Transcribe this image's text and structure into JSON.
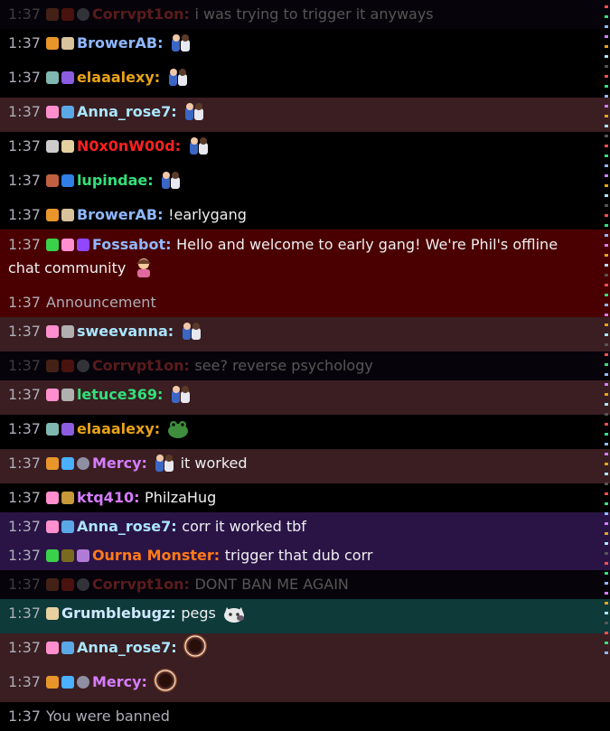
{
  "messages": [
    {
      "time": "1:37",
      "user": "Corrvpt1on",
      "color": "#ff4d4d",
      "text": "i was trying to trigger it anyways",
      "bg": "#120a1e",
      "dim": true,
      "badges": [
        "#c06040",
        "#d0342c",
        "#8f8fa3"
      ],
      "emote": null
    },
    {
      "time": "1:37",
      "user": "BrowerAB",
      "color": "#8fb8ff",
      "text": "",
      "bg": "#000000",
      "dim": false,
      "badges": [
        "#e8962a",
        "#d9c39c"
      ],
      "emote": "hug-emote"
    },
    {
      "time": "1:37",
      "user": "elaaalexy",
      "color": "#e8a317",
      "text": "",
      "bg": "#000000",
      "dim": false,
      "badges": [
        "#7fb8b0",
        "#8c5de0"
      ],
      "emote": "hug-emote"
    },
    {
      "time": "1:37",
      "user": "Anna_rose7",
      "color": "#a9e6ff",
      "text": "",
      "bg": "#3a1e22",
      "dim": false,
      "badges": [
        "#ff8fcf",
        "#5aa9e6"
      ],
      "emote": "hug-emote"
    },
    {
      "time": "1:37",
      "user": "N0x0nW00d",
      "color": "#ff2020",
      "text": "",
      "bg": "#000000",
      "dim": false,
      "badges": [
        "#cccccc",
        "#e6d0a0"
      ],
      "emote": "hug-emote"
    },
    {
      "time": "1:37",
      "user": "lupindae",
      "color": "#33e07a",
      "text": "",
      "bg": "#000000",
      "dim": false,
      "badges": [
        "#c06040",
        "#2f7fe6"
      ],
      "emote": "hug-emote"
    },
    {
      "time": "1:37",
      "user": "BrowerAB",
      "color": "#8fb8ff",
      "text": "!earlygang",
      "bg": "#000000",
      "dim": false,
      "badges": [
        "#e8962a",
        "#d9c39c"
      ],
      "emote": null
    },
    {
      "time": "1:37",
      "user": "Fossabot",
      "color": "#8fb8ff",
      "text": "Hello and welcome to early gang! We're Phil's offline chat community",
      "bg": "#4a0000",
      "dim": false,
      "badges": [
        "#3ad14a",
        "#ff8fcf",
        "#9146ff"
      ],
      "emote": "pray-emote",
      "wrap": true
    },
    {
      "time": "1:37",
      "user": "",
      "color": "#adadb8",
      "text": "Announcement",
      "bg": "#4a0000",
      "dim": false,
      "badges": [],
      "emote": null,
      "system": true
    },
    {
      "time": "1:37",
      "user": "sweevanna",
      "color": "#a9e6ff",
      "text": "",
      "bg": "#3a1e22",
      "dim": false,
      "badges": [
        "#ff8fcf",
        "#b0b0b0"
      ],
      "emote": "hug-emote"
    },
    {
      "time": "1:37",
      "user": "Corrvpt1on",
      "color": "#ff4d4d",
      "text": "see? reverse psychology",
      "bg": "#120a1e",
      "dim": true,
      "badges": [
        "#c06040",
        "#d0342c",
        "#8f8fa3"
      ],
      "emote": null
    },
    {
      "time": "1:37",
      "user": "letuce369",
      "color": "#33e07a",
      "text": "",
      "bg": "#3a1e22",
      "dim": false,
      "badges": [
        "#ff8fcf",
        "#b0b0b0"
      ],
      "emote": "hug-emote"
    },
    {
      "time": "1:37",
      "user": "elaaalexy",
      "color": "#e8a317",
      "text": "",
      "bg": "#000000",
      "dim": false,
      "badges": [
        "#7fb8b0",
        "#8c5de0"
      ],
      "emote": "frog-emote"
    },
    {
      "time": "1:37",
      "user": "Mercy",
      "color": "#d67cff",
      "text": "it worked",
      "bg": "#3a1e22",
      "dim": false,
      "badges": [
        "#e8962a",
        "#4ab0ff",
        "#8f8fa3"
      ],
      "emote": "hug-emote",
      "emoteFirst": true
    },
    {
      "time": "1:37",
      "user": "ktq410",
      "color": "#d67cff",
      "text": "PhilzaHug",
      "bg": "#000000",
      "dim": false,
      "badges": [
        "#ff8fcf",
        "#c89a3a"
      ],
      "emote": null
    },
    {
      "time": "1:37",
      "user": "Anna_rose7",
      "color": "#a9e6ff",
      "text": "corr it worked tbf",
      "bg": "#2a1446",
      "dim": false,
      "badges": [
        "#ff8fcf",
        "#5aa9e6"
      ],
      "emote": null
    },
    {
      "time": "1:37",
      "user": "Ourna Monster",
      "color": "#ff7a1a",
      "text": "trigger that dub corr",
      "bg": "#2a1446",
      "dim": false,
      "badges": [
        "#3ad14a",
        "#7a6a20",
        "#b07ad6"
      ],
      "emote": null
    },
    {
      "time": "1:37",
      "user": "Corrvpt1on",
      "color": "#ff4d4d",
      "text": "DONT BAN ME AGAIN",
      "bg": "#120a1e",
      "dim": true,
      "badges": [
        "#c06040",
        "#d0342c",
        "#8f8fa3"
      ],
      "emote": null
    },
    {
      "time": "1:37",
      "user": "Grumblebugz",
      "color": "#cfe9ff",
      "text": "pegs",
      "bg": "#0e3a3a",
      "dim": false,
      "badges": [
        "#e6d0a0"
      ],
      "emote": "cat-emote"
    },
    {
      "time": "1:37",
      "user": "Anna_rose7",
      "color": "#a9e6ff",
      "text": "",
      "bg": "#3a1e22",
      "dim": false,
      "badges": [
        "#ff8fcf",
        "#5aa9e6"
      ],
      "emote": "ring-emote"
    },
    {
      "time": "1:37",
      "user": "Mercy",
      "color": "#d67cff",
      "text": "",
      "bg": "#3a1e22",
      "dim": false,
      "badges": [
        "#e8962a",
        "#4ab0ff",
        "#8f8fa3"
      ],
      "emote": "ring-emote"
    },
    {
      "time": "1:37",
      "user": "",
      "color": "#adadb8",
      "text": "You were banned",
      "bg": "#000000",
      "dim": false,
      "badges": [],
      "emote": null,
      "system": true
    }
  ]
}
